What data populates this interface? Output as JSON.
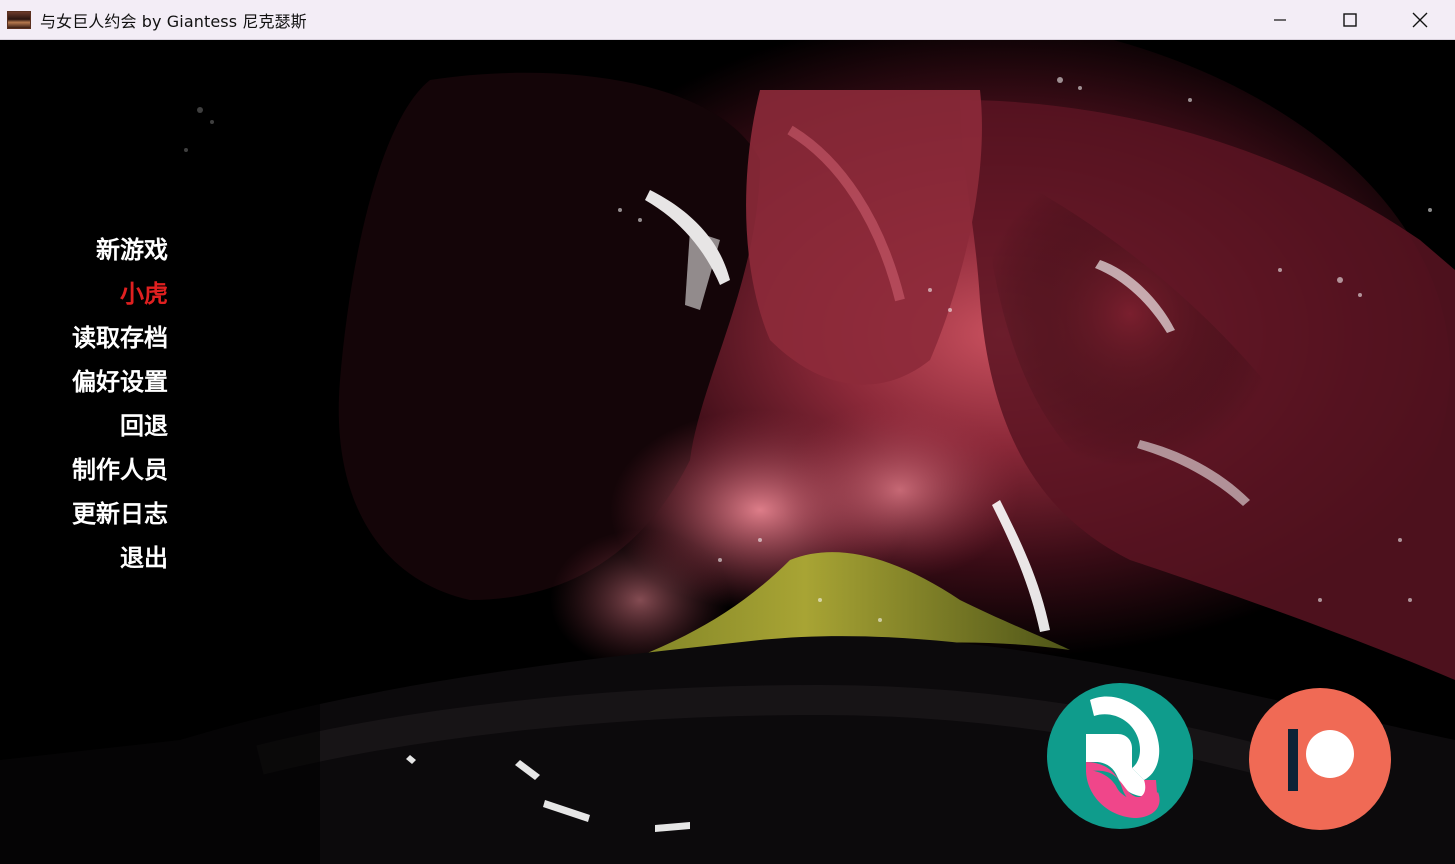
{
  "window": {
    "title": "与女巨人约会 by Giantess 尼克瑟斯",
    "icon": "game-thumbnail-icon",
    "controls": [
      "minimize-icon",
      "maximize-icon",
      "close-icon"
    ]
  },
  "menu": {
    "items": [
      {
        "label": "新游戏",
        "active": false
      },
      {
        "label": "小虎",
        "active": true
      },
      {
        "label": "读取存档",
        "active": false
      },
      {
        "label": "偏好设置",
        "active": false
      },
      {
        "label": "回退",
        "active": false
      },
      {
        "label": "制作人员",
        "active": false
      },
      {
        "label": "更新日志",
        "active": false
      },
      {
        "label": "退出",
        "active": false
      }
    ],
    "active_color": "#e02020",
    "text_color": "#ffffff"
  },
  "social": {
    "buttons": [
      {
        "icon": "subscribestar-icon",
        "bg_color": "#0f9c8c"
      },
      {
        "icon": "patreon-icon",
        "bg_color": "#f06a55"
      }
    ]
  }
}
